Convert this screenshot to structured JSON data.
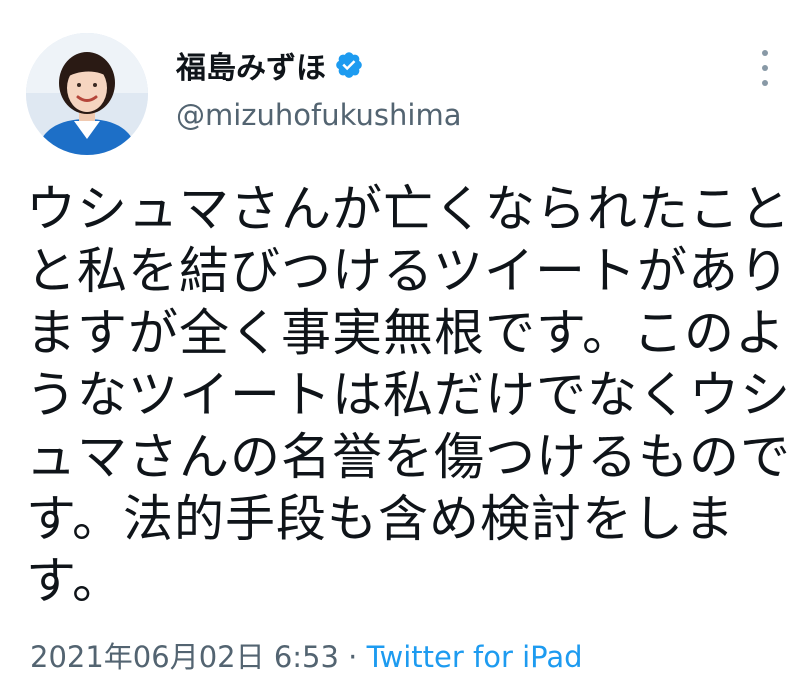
{
  "tweet": {
    "author": {
      "display_name": "福島みずほ",
      "handle": "@mizuhofukushima",
      "verified": true,
      "avatar": "profile-photo-icon"
    },
    "more_icon": "more-vertical-icon",
    "text_lines": [
      "ウシュマさんが亡くなられたこと",
      "と私を結びつけるツイートがあり",
      "ますが全く事実無根です。このよ",
      "うなツイートは私だけでなくウシ",
      "ュマさんの名誉を傷つけるもので",
      "す。法的手段も含め検討をしま",
      "す。"
    ],
    "timestamp": "2021年06月02日 6:53",
    "separator": " · ",
    "source": "Twitter for iPad"
  },
  "colors": {
    "text_primary": "#0f1419",
    "text_secondary": "#536471",
    "accent": "#1d9bf0",
    "verified_badge": "#1d9bf0",
    "background": "#ffffff"
  }
}
